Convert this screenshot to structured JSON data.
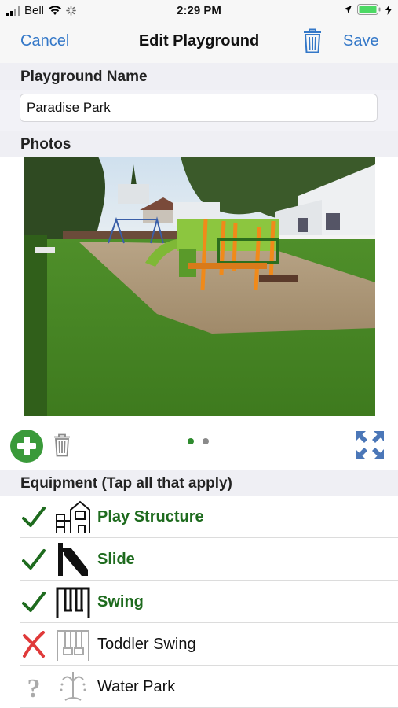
{
  "status_bar": {
    "carrier": "Bell",
    "time": "2:29 PM"
  },
  "nav": {
    "cancel_label": "Cancel",
    "title": "Edit Playground",
    "save_label": "Save",
    "trash_icon": "trash-icon",
    "accent_color": "#3478c8"
  },
  "playground_name": {
    "header": "Playground Name",
    "value": "Paradise Park"
  },
  "photos": {
    "header": "Photos",
    "page_count": 2,
    "current_page": 1,
    "active_dot_color": "#2e8b2e",
    "inactive_dot_color": "#8a8a8a",
    "add_icon": "add-circle-icon",
    "delete_icon": "trash-icon",
    "expand_icon": "expand-icon"
  },
  "equipment": {
    "header": "Equipment (Tap all that apply)",
    "items": [
      {
        "label": "Play Structure",
        "state": "yes",
        "icon": "play-structure-icon"
      },
      {
        "label": "Slide",
        "state": "yes",
        "icon": "slide-icon"
      },
      {
        "label": "Swing",
        "state": "yes",
        "icon": "swing-icon"
      },
      {
        "label": "Toddler Swing",
        "state": "no",
        "icon": "toddler-swing-icon"
      },
      {
        "label": "Water Park",
        "state": "unknown",
        "icon": "water-park-icon"
      }
    ]
  }
}
